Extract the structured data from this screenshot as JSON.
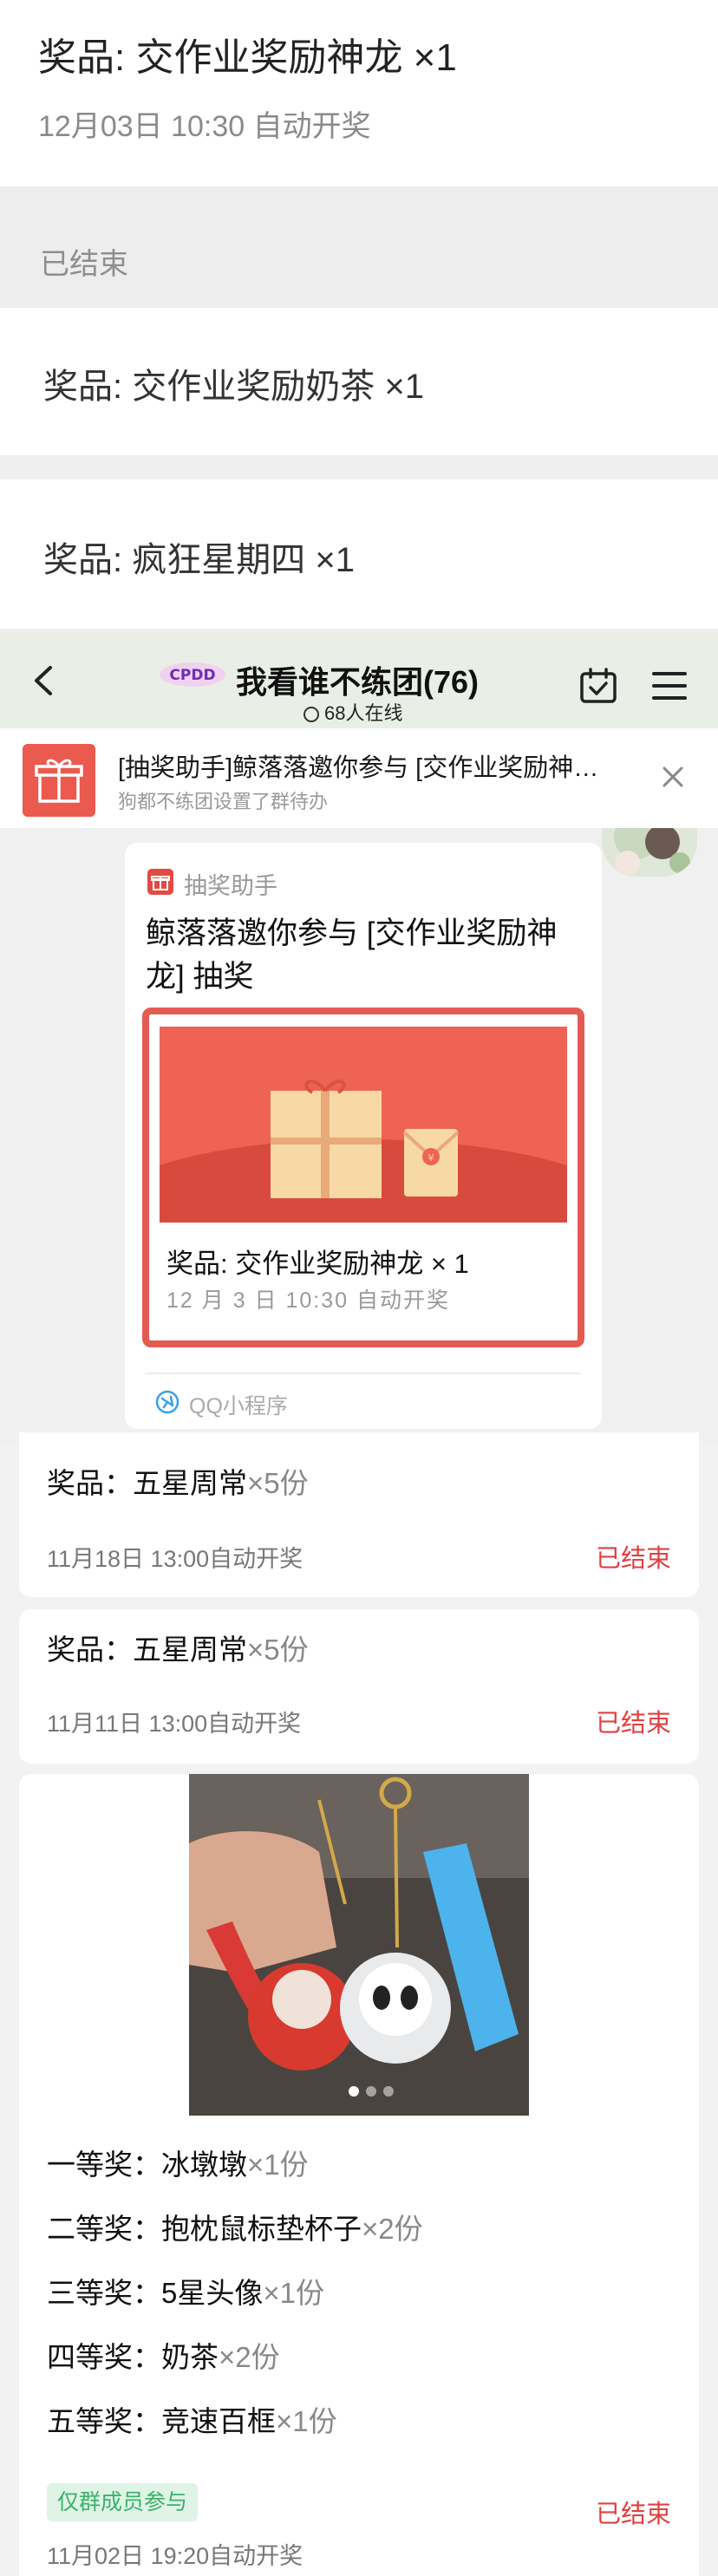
{
  "prize_list": {
    "current": {
      "title": "奖品: 交作业奖励神龙 ×1",
      "schedule": "12月03日 10:30 自动开奖"
    },
    "ended_header": "已结束",
    "ended_items": [
      {
        "title": "奖品: 交作业奖励奶茶  ×1"
      },
      {
        "title": "奖品: 疯狂星期四  ×1"
      }
    ]
  },
  "chat": {
    "group_name": "我看谁不练团(76)",
    "online": "68人在线",
    "notice": {
      "title": "[抽奖助手]鲸落落邀你参与 [交作业奖励神龙] 抽奖",
      "subtitle": "狗都不练团设置了群待办"
    },
    "card": {
      "app_name": "抽奖助手",
      "title": "鲸落落邀你参与 [交作业奖励神龙] 抽奖",
      "prize": "奖品: 交作业奖励神龙  × 1",
      "time": "12 月 3 日 10:30 自动开奖",
      "footer": "QQ小程序"
    }
  },
  "records": [
    {
      "prize_label": "奖品：",
      "prize_name": "五星周常",
      "mult": "×5份",
      "time": "11月18日 13:00自动开奖",
      "status": "已结束"
    },
    {
      "prize_label": "奖品：",
      "prize_name": "五星周常",
      "mult": "×5份",
      "time": "11月11日 13:00自动开奖",
      "status": "已结束"
    }
  ],
  "record_multi": {
    "tiers": [
      {
        "label": "一等奖：",
        "name": "冰墩墩",
        "mult": "×1份"
      },
      {
        "label": "二等奖：",
        "name": "抱枕鼠标垫杯子",
        "mult": "×2份"
      },
      {
        "label": "三等奖：",
        "name": "5星头像",
        "mult": "×1份"
      },
      {
        "label": "四等奖：",
        "name": "奶茶",
        "mult": "×2份"
      },
      {
        "label": "五等奖：",
        "name": "竞速百框",
        "mult": "×1份"
      }
    ],
    "badge": "仅群成员参与",
    "status": "已结束",
    "time": "11月02日 19:20自动开奖"
  },
  "colors": {
    "accent_red": "#e04040",
    "gift_red": "#ea5a4e",
    "badge_green": "#3bb26a",
    "header_green": "#e9efe6"
  },
  "icons": [
    "back-icon",
    "group-logo-icon",
    "calendar-check-icon",
    "menu-icon",
    "gift-icon",
    "close-icon",
    "qq-mini-program-icon",
    "online-indicator-icon"
  ]
}
